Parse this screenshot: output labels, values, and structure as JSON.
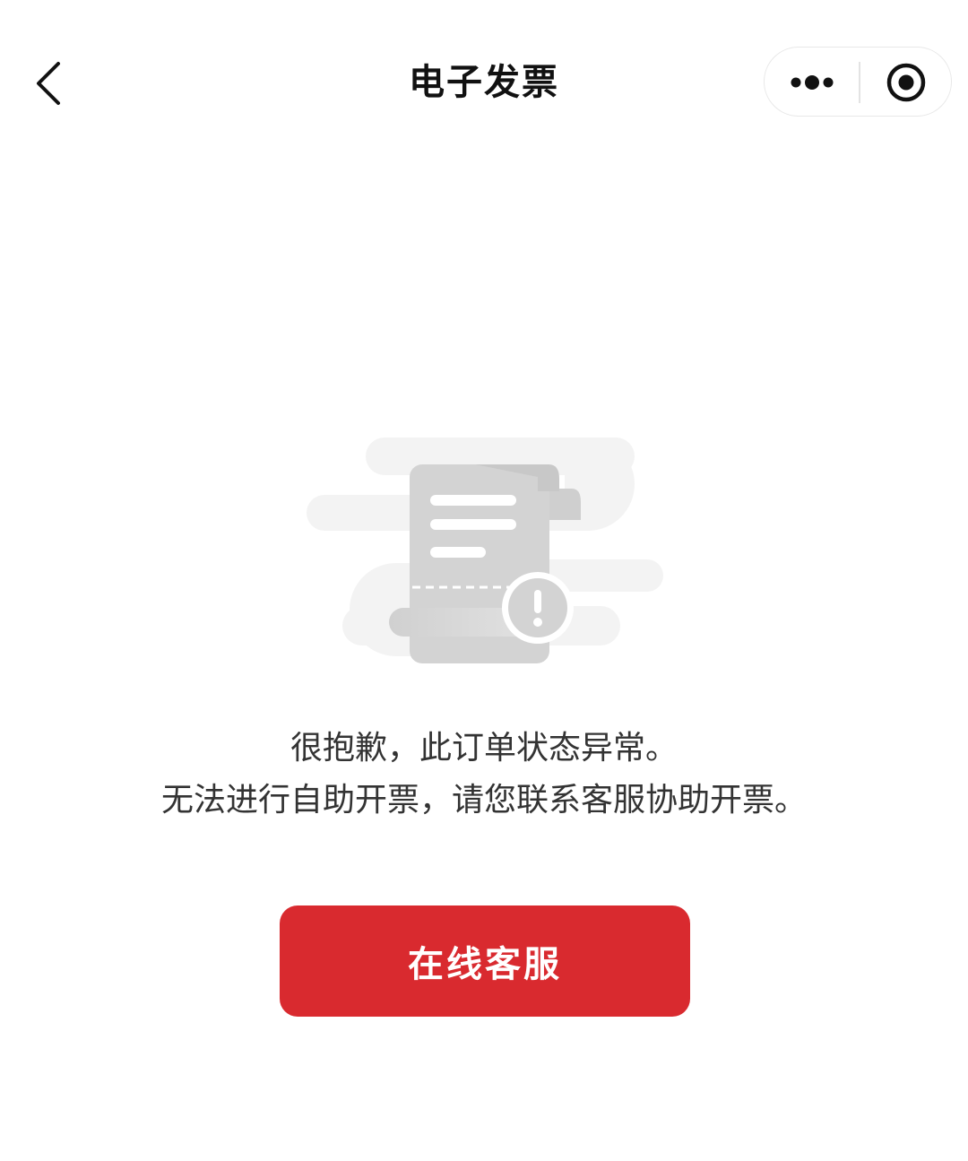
{
  "nav": {
    "title": "电子发票",
    "back_icon": "chevron-left-icon",
    "more_icon": "more-dots-icon",
    "close_icon": "target-circle-icon"
  },
  "empty_state": {
    "illustration_icon": "invoice-warning-icon",
    "message_line1": "很抱歉，此订单状态异常。",
    "message_line2": "无法进行自助开票，请您联系客服协助开票。"
  },
  "actions": {
    "contact_label": "在线客服"
  },
  "colors": {
    "primary": "#d92a2f",
    "text_primary": "#111111",
    "text_secondary": "#333333",
    "illustration_gray": "#d4d4d4"
  }
}
